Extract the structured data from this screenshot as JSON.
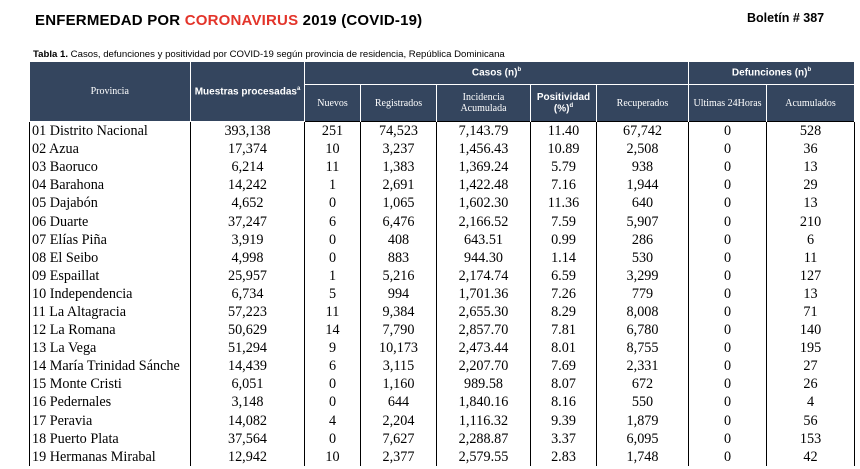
{
  "header": {
    "title_prefix": "ENFERMEDAD POR ",
    "title_accent": "CORONAVIRUS",
    "title_suffix": " 2019 (COVID-19)",
    "bulletin": "Boletín # 387"
  },
  "caption": {
    "label": "Tabla 1.",
    "text": " Casos, defunciones y positividad por COVID-19 según provincia de residencia, República Dominicana"
  },
  "colors": {
    "header_bg": "#34455e",
    "accent": "#e3342a"
  },
  "table": {
    "headers": {
      "provincia": "Provincia",
      "muestras": "Muestras procesadas",
      "muestras_sup": "a",
      "casos": "Casos (n)",
      "casos_sup": "b",
      "defunciones": "Defunciones (n)",
      "defunciones_sup": "b",
      "nuevos": "Nuevos",
      "registrados": "Registrados",
      "incidencia": "Incidencia Acumulada",
      "positividad": "Positividad (%)",
      "positividad_sup": "d",
      "recuperados": "Recuperados",
      "ultimas": "Ultimas 24Horas",
      "acumulados": "Acumulados"
    },
    "rows": [
      [
        "01 Distrito Nacional",
        "393,138",
        "251",
        "74,523",
        "7,143.79",
        "11.40",
        "67,742",
        "0",
        "528"
      ],
      [
        "02 Azua",
        "17,374",
        "10",
        "3,237",
        "1,456.43",
        "10.89",
        "2,508",
        "0",
        "36"
      ],
      [
        "03 Baoruco",
        "6,214",
        "11",
        "1,383",
        "1,369.24",
        "5.79",
        "938",
        "0",
        "13"
      ],
      [
        "04 Barahona",
        "14,242",
        "1",
        "2,691",
        "1,422.48",
        "7.16",
        "1,944",
        "0",
        "29"
      ],
      [
        "05 Dajabón",
        "4,652",
        "0",
        "1,065",
        "1,602.30",
        "11.36",
        "640",
        "0",
        "13"
      ],
      [
        "06 Duarte",
        "37,247",
        "6",
        "6,476",
        "2,166.52",
        "7.59",
        "5,907",
        "0",
        "210"
      ],
      [
        "07 Elías Piña",
        "3,919",
        "0",
        "408",
        "643.51",
        "0.99",
        "286",
        "0",
        "6"
      ],
      [
        "08 El Seibo",
        "4,998",
        "0",
        "883",
        "944.30",
        "1.14",
        "530",
        "0",
        "11"
      ],
      [
        "09 Espaillat",
        "25,957",
        "1",
        "5,216",
        "2,174.74",
        "6.59",
        "3,299",
        "0",
        "127"
      ],
      [
        "10 Independencia",
        "6,734",
        "5",
        "994",
        "1,701.36",
        "7.26",
        "779",
        "0",
        "13"
      ],
      [
        "11 La Altagracia",
        "57,223",
        "11",
        "9,384",
        "2,655.30",
        "8.29",
        "8,008",
        "0",
        "71"
      ],
      [
        "12 La Romana",
        "50,629",
        "14",
        "7,790",
        "2,857.70",
        "7.81",
        "6,780",
        "0",
        "140"
      ],
      [
        "13 La Vega",
        "51,294",
        "9",
        "10,173",
        "2,473.44",
        "8.01",
        "8,755",
        "0",
        "195"
      ],
      [
        "14 María Trinidad Sánche",
        "14,439",
        "6",
        "3,115",
        "2,207.70",
        "7.69",
        "2,331",
        "0",
        "27"
      ],
      [
        "15 Monte Cristi",
        "6,051",
        "0",
        "1,160",
        "989.58",
        "8.07",
        "672",
        "0",
        "26"
      ],
      [
        "16 Pedernales",
        "3,148",
        "0",
        "644",
        "1,840.16",
        "8.16",
        "550",
        "0",
        "4"
      ],
      [
        "17 Peravia",
        "14,082",
        "4",
        "2,204",
        "1,116.32",
        "9.39",
        "1,879",
        "0",
        "56"
      ],
      [
        "18 Puerto Plata",
        "37,564",
        "0",
        "7,627",
        "2,288.87",
        "3.37",
        "6,095",
        "0",
        "153"
      ],
      [
        "19 Hermanas Mirabal",
        "12,942",
        "10",
        "2,377",
        "2,579.55",
        "2.83",
        "1,748",
        "0",
        "42"
      ]
    ]
  }
}
